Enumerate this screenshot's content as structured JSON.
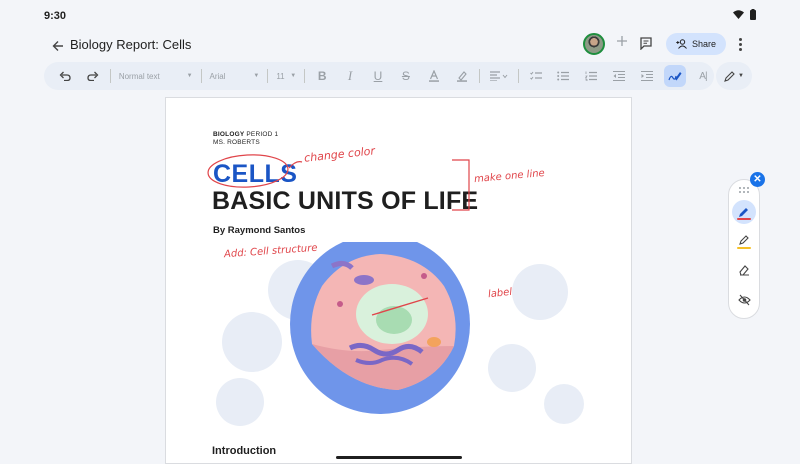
{
  "status_bar": {
    "time": "9:30"
  },
  "app_bar": {
    "title": "Biology Report: Cells",
    "share_label": "Share"
  },
  "toolbar": {
    "style_label": "Normal text",
    "font_label": "Arial",
    "size_label": "11",
    "buttons": [
      "undo-icon",
      "redo-icon",
      "bold-icon",
      "italic-icon",
      "underline-icon",
      "strikethrough-icon",
      "text-color-icon",
      "highlight-icon",
      "align-icon",
      "checklist-icon",
      "bulleted-list-icon",
      "numbered-list-icon",
      "decrease-indent-icon",
      "increase-indent-icon",
      "handwriting-icon",
      "clear-format-icon"
    ]
  },
  "document": {
    "class_bold": "BIOLOGY",
    "class_rest": " PERIOD 1",
    "teacher": "MS. ROBERTS",
    "title": "CELLS",
    "subtitle": "BASIC UNITS OF LIFE",
    "author": "By Raymond Santos",
    "intro_heading": "Introduction"
  },
  "annotations": {
    "change_color": "change color",
    "make_one_line": "make one line",
    "add_structure": "Add: Cell structure",
    "label": "label"
  },
  "pen_panel": {
    "tools": [
      "marker-pen-icon",
      "highlighter-icon",
      "eraser-icon",
      "hide-annotations-icon"
    ],
    "colors": {
      "pen": "#e0454a",
      "highlighter": "#f6c026",
      "accent": "#1a73e8",
      "ink": "#e0454a"
    }
  }
}
